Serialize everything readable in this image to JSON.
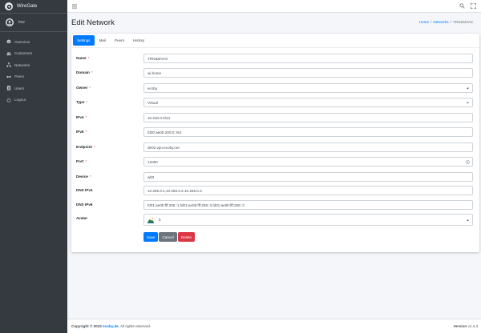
{
  "app": {
    "brand": "WireGate",
    "user": "tnw"
  },
  "sidebar": {
    "items": [
      {
        "label": "Overview",
        "icon": "gauge-icon"
      },
      {
        "label": "Customers",
        "icon": "users-icon"
      },
      {
        "label": "Networks",
        "icon": "network-icon"
      },
      {
        "label": "Peers",
        "icon": "peers-icon"
      },
      {
        "label": "Users",
        "icon": "user-badge-icon"
      },
      {
        "label": "Logout",
        "icon": "power-icon"
      }
    ]
  },
  "page": {
    "title": "Edit Network",
    "breadcrumb": [
      "Home",
      "/",
      "Networks",
      "/",
      "TRN&MVAS"
    ]
  },
  "tabs": [
    "Settings",
    "Mail",
    "Peers",
    "History"
  ],
  "form": {
    "name": {
      "label": "Name",
      "value": "TRN&MVAS"
    },
    "domain": {
      "label": "Domain",
      "value": "wi.home"
    },
    "owner": {
      "label": "Owner",
      "value": "ecoby"
    },
    "type": {
      "label": "Type",
      "value": "Virtual"
    },
    "ipv4": {
      "label": "IPv4",
      "value": "10.230.0.0/24"
    },
    "ipv6": {
      "label": "IPv6",
      "value": "fd00:ae0b:200:0::/64"
    },
    "endpoint": {
      "label": "Endpoint",
      "value": "de02.vpn.ecoby.net"
    },
    "port": {
      "label": "Port",
      "value": "12000"
    },
    "device": {
      "label": "Device",
      "value": "wlt3"
    },
    "dns_ipv4": {
      "label": "DNS IPv4",
      "value": "10.255.0.1,10.255.0.2,10.255.0.3"
    },
    "dns_ipv6": {
      "label": "DNS IPv6",
      "value": "fd01:ae0b:fff:255::1,fd01:ae0b:fff:255::2,fd01:ae0b:fff:255::3"
    },
    "avatar": {
      "label": "Avatar",
      "value": "5"
    },
    "required_mark": "*"
  },
  "buttons": {
    "save": "Save",
    "cancel": "Cancel",
    "delete": "Delete"
  },
  "footer": {
    "copyright": "Copyright © 2023",
    "company": "ecoby.de.",
    "rights": "All rights reserved.",
    "version_label": "Version",
    "version": "v1.4.3"
  },
  "colors": {
    "primary": "#007bff",
    "danger": "#dc3545",
    "secondary": "#6c757d",
    "sidebar": "#343a40"
  }
}
